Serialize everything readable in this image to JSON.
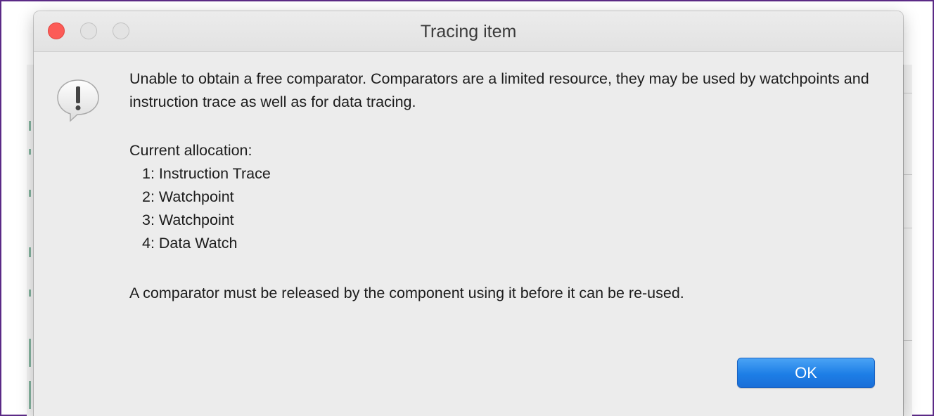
{
  "dialog": {
    "title": "Tracing item",
    "icon": "alert-caution-speech-icon",
    "message_intro": "Unable to obtain a free comparator. Comparators are a limited resource, they may be used by watchpoints and instruction trace as well as for data tracing.",
    "allocation_heading": "Current allocation:",
    "allocations": [
      "1: Instruction Trace",
      "2: Watchpoint",
      "3: Watchpoint",
      "4: Data Watch"
    ],
    "message_footer": "A comparator must be released by the component using it before it can be re-used.",
    "ok_label": "OK"
  },
  "colors": {
    "frame_border": "#5b2a86",
    "close_button": "#fc5b57",
    "ok_button": "#1d7ee6",
    "dialog_bg": "#ececec"
  }
}
